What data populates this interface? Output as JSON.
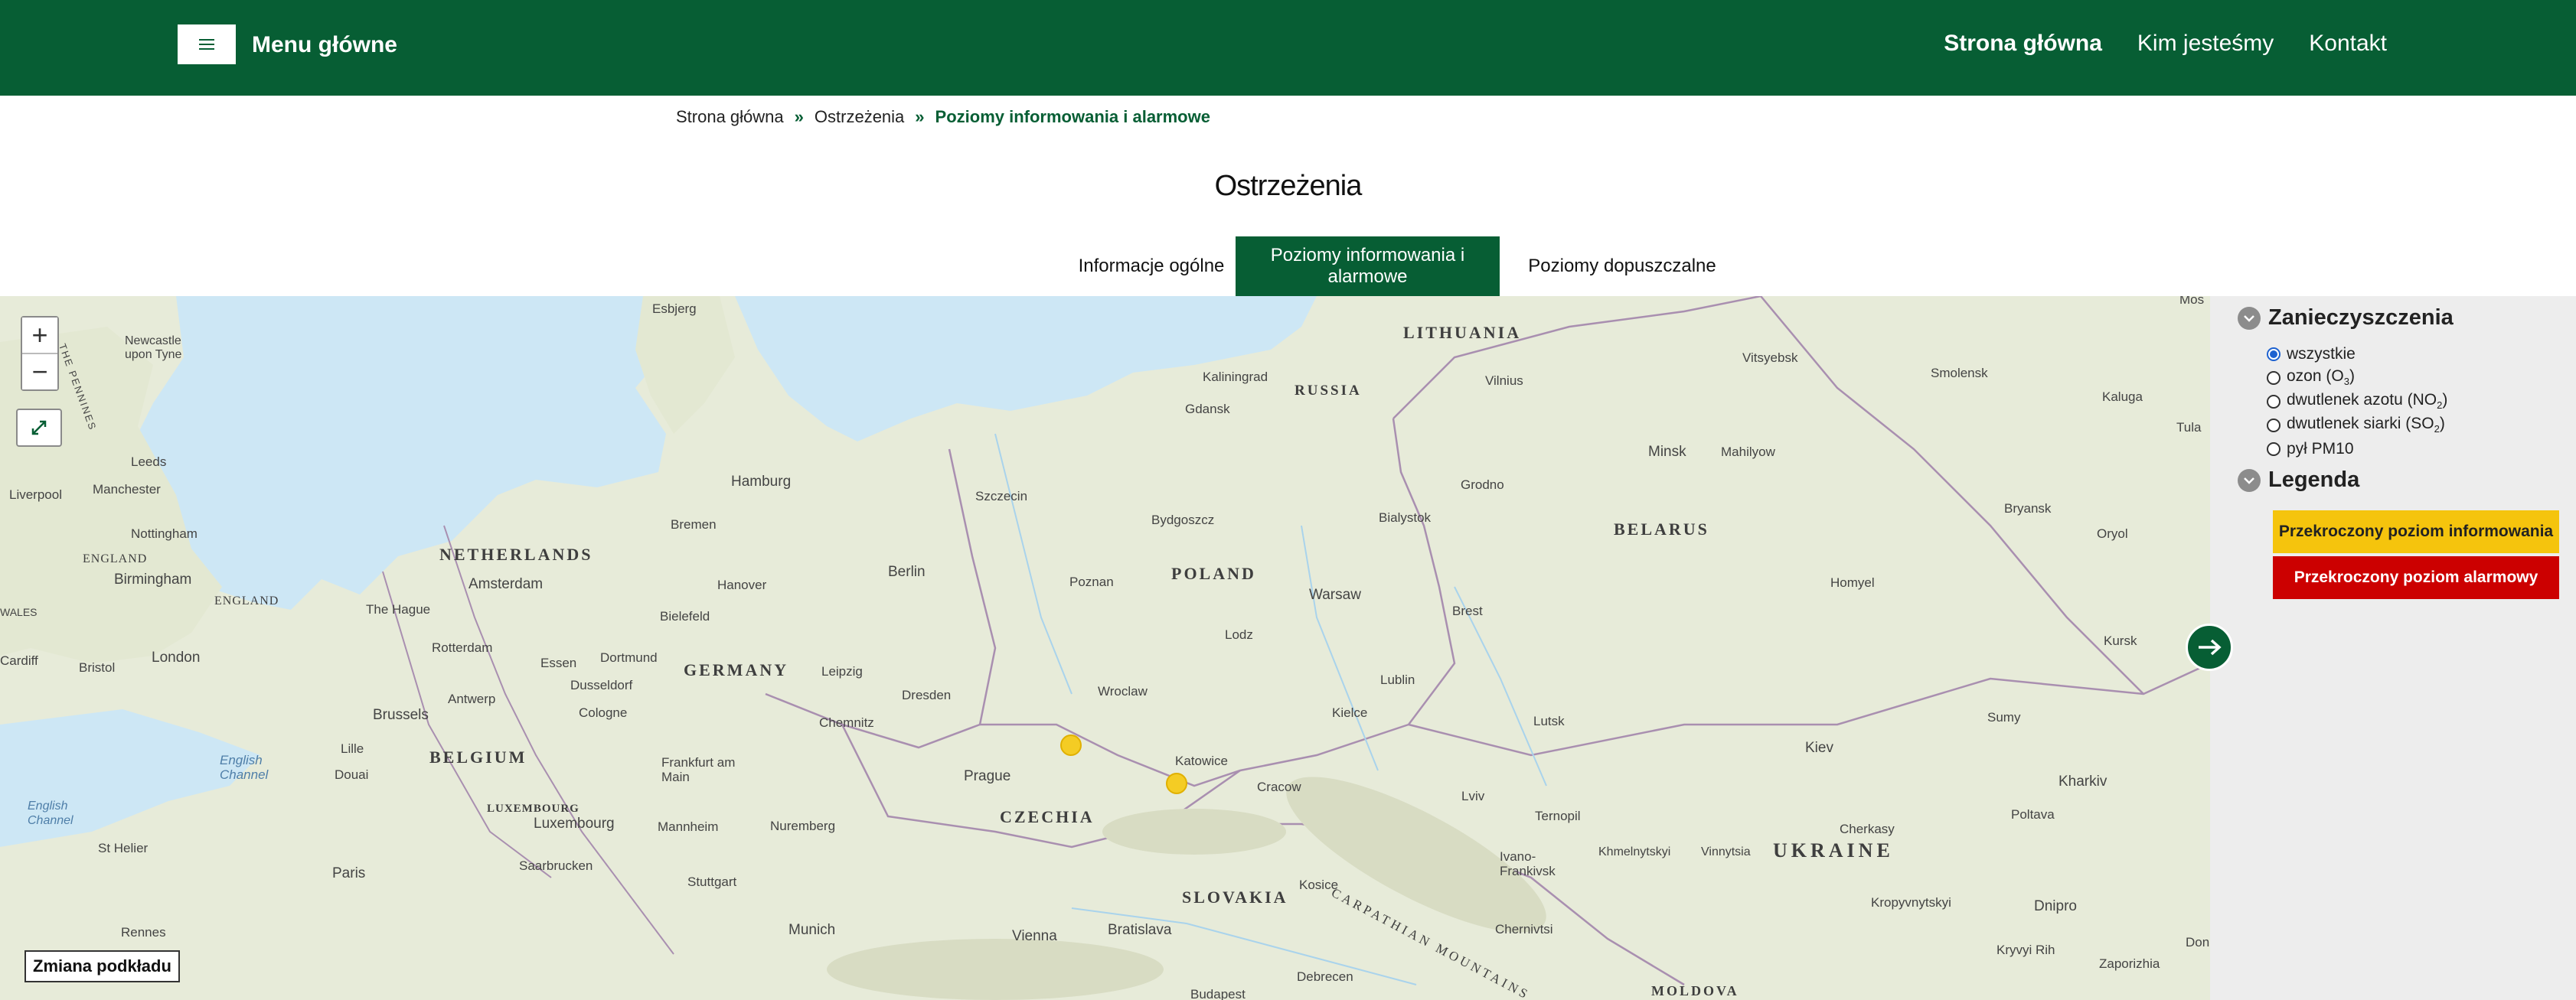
{
  "header": {
    "menu_title": "Menu główne",
    "nav": [
      {
        "label": "Strona główna"
      },
      {
        "label": "Kim jesteśmy"
      },
      {
        "label": "Kontakt"
      }
    ]
  },
  "breadcrumb": {
    "home": "Strona główna",
    "section": "Ostrzeżenia",
    "current": "Poziomy informowania i alarmowe",
    "sep1": "»",
    "sep2": "»"
  },
  "page_title": "Ostrzeżenia",
  "tabs": [
    {
      "label": "Informacje ogólne"
    },
    {
      "label": "Poziomy informowania i alarmowe"
    },
    {
      "label": "Poziomy dopuszczalne"
    }
  ],
  "map": {
    "zoom_in": "+",
    "zoom_out": "−",
    "basemap_button": "Zmiana podkładu",
    "countries": [
      "LITHUANIA",
      "RUSSIA",
      "BELARUS",
      "POLAND",
      "NETHERLANDS",
      "GERMANY",
      "BELGIUM",
      "LUXEMBOURG",
      "CZECHIA",
      "SLOVAKIA",
      "UKRAINE",
      "ENGLAND",
      "MOLDOVA"
    ],
    "cities": [
      "Esbjerg",
      "Newcastle upon Tyne",
      "Leeds",
      "Liverpool",
      "Manchester",
      "Nottingham",
      "Birmingham",
      "Cardiff",
      "Bristol",
      "London",
      "Hamburg",
      "Bremen",
      "Amsterdam",
      "The Hague",
      "Rotterdam",
      "Hanover",
      "Bielefeld",
      "Essen",
      "Dortmund",
      "Dusseldorf",
      "Antwerp",
      "Brussels",
      "Cologne",
      "Lille",
      "Douai",
      "Frankfurt am Main",
      "Luxembourg",
      "Mannheim",
      "Nuremberg",
      "Saarbrucken",
      "Stuttgart",
      "Paris",
      "Rennes",
      "St Helier",
      "Munich",
      "Berlin",
      "Leipzig",
      "Dresden",
      "Chemnitz",
      "Prague",
      "Vienna",
      "Bratislava",
      "Szczecin",
      "Gdansk",
      "Kaliningrad",
      "Bydgoszcz",
      "Poznan",
      "Warsaw",
      "Lodz",
      "Wroclaw",
      "Katowice",
      "Cracow",
      "Kielce",
      "Lublin",
      "Bialystok",
      "Grodno",
      "Vilnius",
      "Minsk",
      "Brest",
      "Lutsk",
      "Lviv",
      "Ternopil",
      "Ivano-Frankivsk",
      "Khmelnytskyi",
      "Vinnytsia",
      "Chernivtsi",
      "Kosice",
      "Debrecen",
      "Kiev",
      "Cherkasy",
      "Poltava",
      "Kharkiv",
      "Sumy",
      "Kursk",
      "Bryansk",
      "Oryol",
      "Homyel",
      "Mahilyow",
      "Smolensk",
      "Vitsyebsk",
      "Kaluga",
      "Tula",
      "Kropyvnytskyi",
      "Dnipro",
      "Kryvyi Rih",
      "Zaporizhia",
      "Budapest",
      "Mos",
      "Don"
    ],
    "seas": [
      "English Channel",
      "English Channel"
    ],
    "mountains": "CARPATHIAN MOUNTAINS",
    "region_labels": [
      "THE PENNINES",
      "WALES"
    ]
  },
  "panel": {
    "pollutants_heading": "Zanieczyszczenia",
    "options": [
      {
        "label": "wszystkie",
        "checked": true
      },
      {
        "label": "ozon (O",
        "sub": "3",
        "tail": ")"
      },
      {
        "label": "dwutlenek azotu (NO",
        "sub": "2",
        "tail": ")"
      },
      {
        "label": "dwutlenek siarki (SO",
        "sub": "2",
        "tail": ")"
      },
      {
        "label": "pył PM10"
      }
    ],
    "legend_heading": "Legenda",
    "legend": {
      "info": "Przekroczony poziom informowania",
      "alarm": "Przekroczony poziom alarmowy"
    },
    "colors": {
      "info": "#f5c40d",
      "alarm": "#cc0000",
      "brand": "#075e34"
    }
  },
  "icons": [
    "hamburger-icon",
    "fullscreen-icon",
    "chevron-down-icon",
    "arrow-right-icon"
  ]
}
